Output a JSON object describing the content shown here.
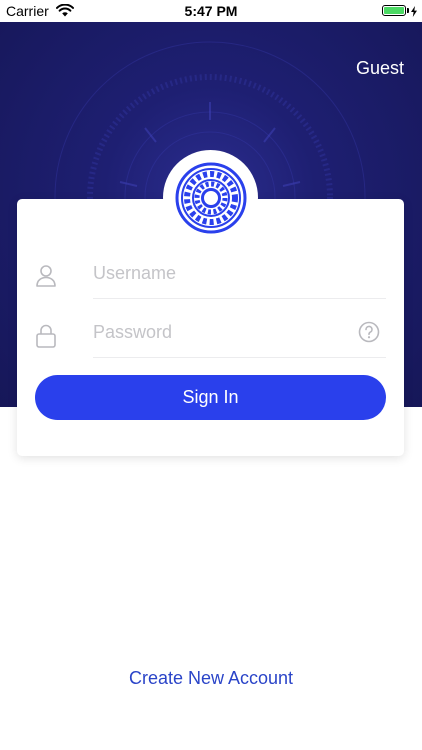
{
  "status_bar": {
    "carrier": "Carrier",
    "time": "5:47 PM",
    "battery_level": 1.0,
    "battery_color": "#4cd964",
    "charging_icon": "bolt-icon",
    "wifi_icon": "wifi-icon"
  },
  "header": {
    "guest_label": "Guest",
    "background_color": "#1e1f72"
  },
  "login_form": {
    "logo_icon": "greek-key-emblem-icon",
    "username": {
      "value": "",
      "placeholder": "Username",
      "icon": "user-icon"
    },
    "password": {
      "value": "",
      "placeholder": "Password",
      "icon": "lock-icon",
      "help_icon": "question-circle-icon"
    },
    "sign_in_label": "Sign In",
    "accent_color": "#2a40ec"
  },
  "footer": {
    "create_account_label": "Create New Account"
  }
}
